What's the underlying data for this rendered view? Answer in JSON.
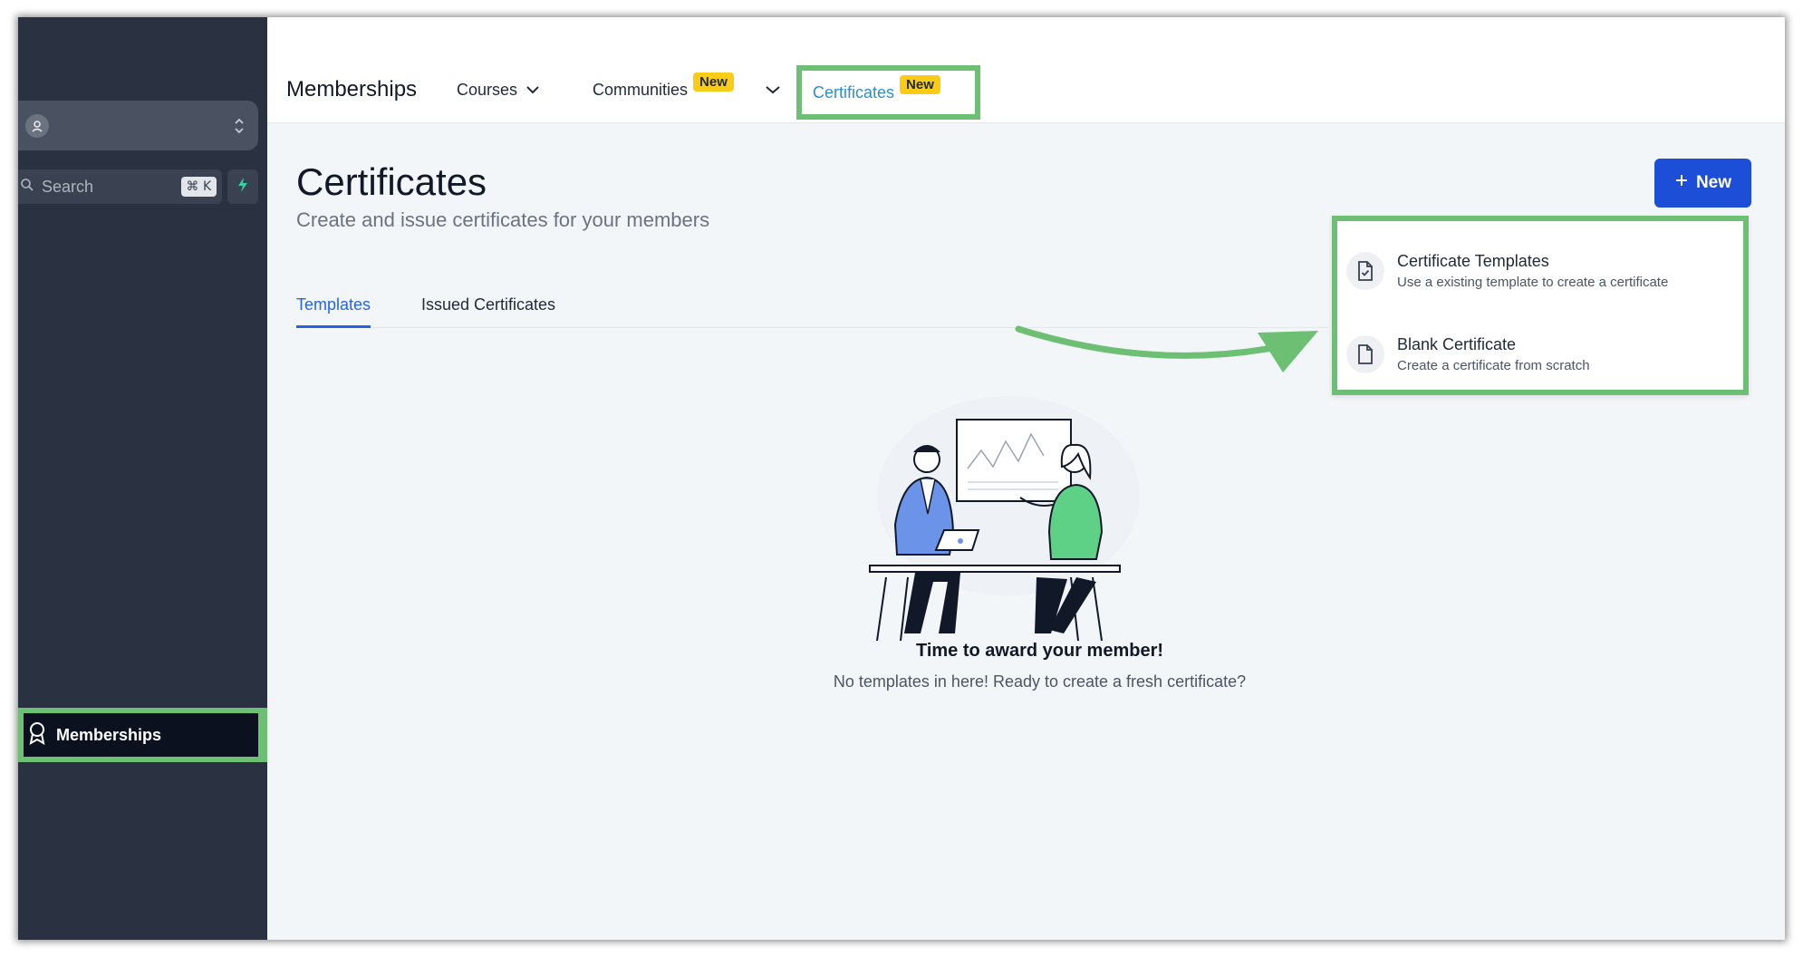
{
  "sidebar": {
    "search_label": "Search",
    "search_shortcut": "⌘ K",
    "nav_memberships_label": "Memberships"
  },
  "topnav": {
    "brand": "Memberships",
    "courses_label": "Courses",
    "communities_label": "Communities",
    "communities_badge": "New",
    "certificates_label": "Certificates",
    "certificates_badge": "New"
  },
  "page": {
    "title": "Certificates",
    "subtitle": "Create and issue certificates for your members",
    "tabs": [
      {
        "label": "Templates",
        "active": true
      },
      {
        "label": "Issued Certificates",
        "active": false
      }
    ],
    "new_button_label": "New"
  },
  "dropdown": {
    "items": [
      {
        "title": "Certificate Templates",
        "description": "Use a existing template to create a certificate",
        "icon": "file-check-icon"
      },
      {
        "title": "Blank Certificate",
        "description": "Create a certificate from scratch",
        "icon": "file-icon"
      }
    ]
  },
  "empty_state": {
    "title": "Time to award your member!",
    "description": "No templates in here! Ready to create a fresh certificate?"
  },
  "colors": {
    "sidebar_bg": "#2a3140",
    "highlight_green": "#6cbf73",
    "primary_blue": "#1d4ed8",
    "link_blue": "#2f8ecf",
    "badge_yellow": "#facc15"
  }
}
